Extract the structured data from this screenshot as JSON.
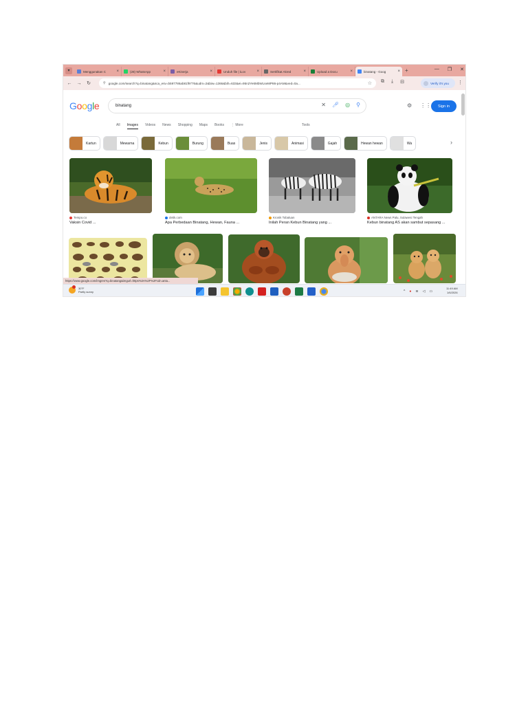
{
  "browser": {
    "tabs": [
      {
        "title": "Menggunakan C",
        "color": "#5b7fd6",
        "active": false
      },
      {
        "title": "(28) WhatsApp",
        "color": "#25d366",
        "active": false
      },
      {
        "title": "eKinerja",
        "color": "#7b5ea7",
        "active": false
      },
      {
        "title": "Unduh file | iLov",
        "color": "#e53935",
        "active": false
      },
      {
        "title": "Sertifikat Akred",
        "color": "#666666",
        "active": false
      },
      {
        "title": "Upload a Docu",
        "color": "#188038",
        "active": false
      },
      {
        "title": "binatang - Goog",
        "color": "#4285f4",
        "active": true
      }
    ],
    "address": "google.com/search?q=binatang&sca_esv=b597786ab81f9776&udm=2&biw=1366&bih=633&ei=95n2Ye6MbWLseMP86-p4AM&ved=0a...",
    "verify_label": "Verify it's you",
    "status_link": "https://www.google.com/imgres?q=binatang&imgurl=https%3A%2F%2Fcdn.anta..."
  },
  "google": {
    "logo_letters": [
      {
        "ch": "G",
        "color": "#4285f4"
      },
      {
        "ch": "o",
        "color": "#ea4335"
      },
      {
        "ch": "o",
        "color": "#fbbc05"
      },
      {
        "ch": "g",
        "color": "#4285f4"
      },
      {
        "ch": "l",
        "color": "#34a853"
      },
      {
        "ch": "e",
        "color": "#ea4335"
      }
    ],
    "query": "binatang",
    "signin_label": "Sign in",
    "categories": [
      "All",
      "Images",
      "Videos",
      "News",
      "Shopping",
      "Maps",
      "Books",
      "⋮ More"
    ],
    "active_category": "Images",
    "tools_label": "Tools",
    "chips": [
      {
        "label": "Kartun",
        "color": "#c47b3a"
      },
      {
        "label": "Mewarna",
        "color": "#d8d8d8"
      },
      {
        "label": "Kebun",
        "color": "#7a6a3a"
      },
      {
        "label": "Burung",
        "color": "#6b8e3a"
      },
      {
        "label": "Buas",
        "color": "#9a7a5a"
      },
      {
        "label": "Jenis",
        "color": "#c9b79a"
      },
      {
        "label": "Animasi",
        "color": "#d8c8a8"
      },
      {
        "label": "Gajah",
        "color": "#8a8a8a"
      },
      {
        "label": "Hewan hewan",
        "color": "#5a6a4a"
      },
      {
        "label": "Wa",
        "color": "#e0e0e0"
      }
    ]
  },
  "results_row1": [
    {
      "source": "Tempo.co",
      "caption": "Vaksin Covid ...",
      "dot": "#e53935"
    },
    {
      "source": "detik.com",
      "caption": "Apa Perbedaan Binatang, Hewan, Fauna ...",
      "dot": "#1a73e8"
    },
    {
      "source": "Kronik Tobaluan",
      "caption": "Inilah Peran Kebun Binatang yang ...",
      "dot": "#f29900"
    },
    {
      "source": "ANTARA News Palu, Sulawesi Tengah",
      "caption": "Kebun binatang AS akan sambut sepasang ...",
      "dot": "#d93025"
    }
  ],
  "taskbar": {
    "weather_temp": "30°F",
    "weather_desc": "Partly sunny",
    "time": "11:49 AM",
    "date": "1/6/2026"
  }
}
